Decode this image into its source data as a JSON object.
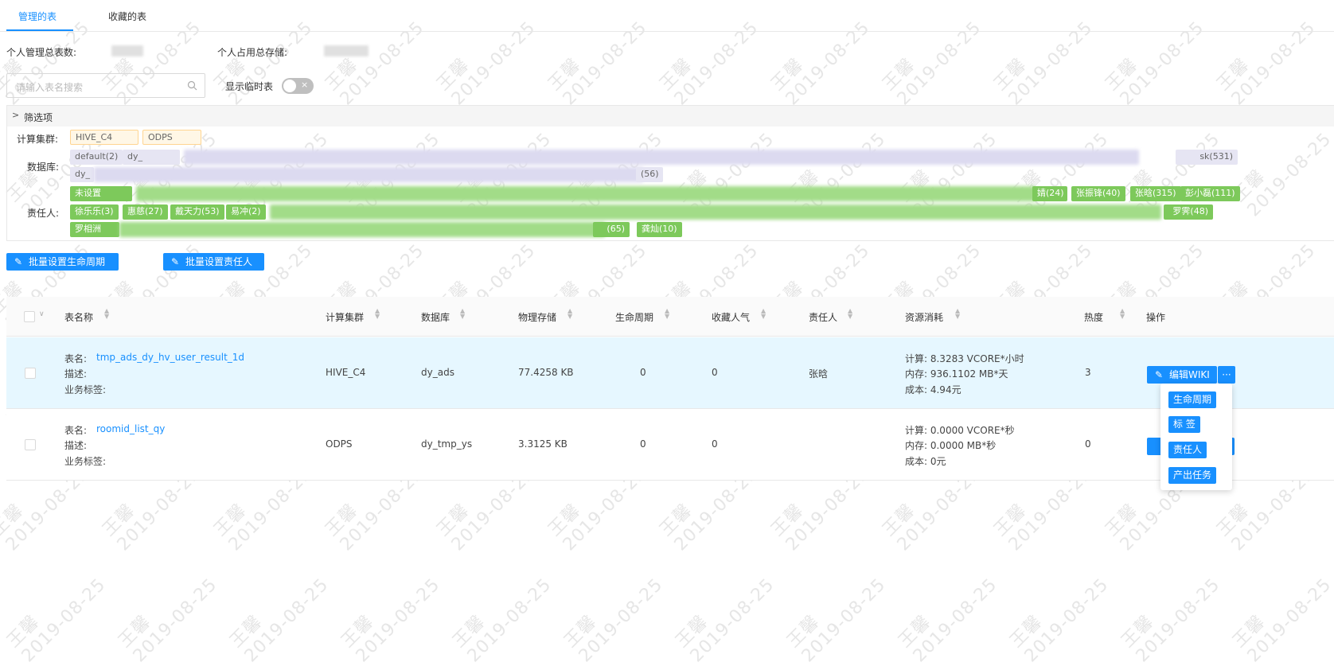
{
  "tabs": [
    {
      "label": "管理的表"
    },
    {
      "label": "收藏的表"
    }
  ],
  "summary": {
    "total_tables_label": "个人管理总表数:",
    "total_storage_label": "个人占用总存储:"
  },
  "search": {
    "placeholder": "请输入表名搜索"
  },
  "temp_toggle": {
    "label": "显示临时表",
    "state_icon": "×"
  },
  "filter": {
    "title": "筛选项",
    "cluster_label": "计算集群:",
    "clusters": [
      "HIVE_C4",
      "ODPS"
    ],
    "database_label": "数据库:",
    "databases": [
      "default(2)",
      "dy_",
      "dy_",
      "sk(531)",
      "(56)"
    ],
    "owner_label": "责任人:",
    "owners_row1": [
      "未设置",
      "婧(24)",
      "张振锋(40)",
      "张晗(315)",
      "彭小磊(111)"
    ],
    "owners_row2": [
      "徐乐乐(3)",
      "惠慈(27)",
      "戴天力(53)",
      "易冲(2)",
      "罗霁(48)"
    ],
    "owners_row3": [
      "罗相洲",
      "(65)",
      "龚灿(10)"
    ]
  },
  "actions": {
    "lifecycle": "批量设置生命周期",
    "owner": "批量设置责任人"
  },
  "table": {
    "headers": [
      "表名称",
      "计算集群",
      "数据库",
      "物理存储",
      "生命周期",
      "收藏人气",
      "责任人",
      "资源消耗",
      "热度",
      "操作"
    ],
    "rows": [
      {
        "name_label": "表名:",
        "name": "tmp_ads_dy_hv_user_result_1d",
        "desc_label": "描述:",
        "biz_label": "业务标签:",
        "cluster": "HIVE_C4",
        "db": "dy_ads",
        "storage": "77.4258 KB",
        "lifecycle": "0",
        "fav": "0",
        "owner": "张晗",
        "cpu": "计算:  8.3283 VCORE*小时",
        "mem": "内存:  936.1102 MB*天",
        "cost": "成本:  4.94元",
        "heat": "3"
      },
      {
        "name_label": "表名:",
        "name": "roomid_list_qy",
        "desc_label": "描述:",
        "biz_label": "业务标签:",
        "cluster": "ODPS",
        "db": "dy_tmp_ys",
        "storage": "3.3125 KB",
        "lifecycle": "0",
        "fav": "0",
        "owner": "",
        "cpu": "计算:  0.0000 VCORE*秒",
        "mem": "内存:  0.0000 MB*秒",
        "cost": "成本:  0元",
        "heat": "0"
      }
    ],
    "edit_wiki": "编辑WIKI",
    "more": "···"
  },
  "popover": {
    "items": [
      "生命周期",
      "标 签",
      "责任人",
      "产出任务"
    ]
  },
  "watermark": {
    "name": "王馨",
    "date": "2019-08-25"
  }
}
